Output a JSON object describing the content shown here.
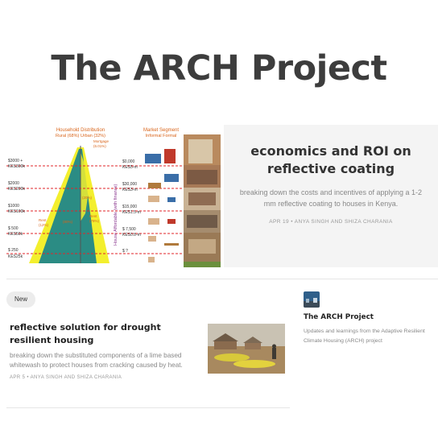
{
  "site": {
    "title": "The ARCH Project"
  },
  "featured": {
    "title": "economics and ROI on reflective coating",
    "subtitle": "breaking down the costs and incentives of applying a 1-2 mm reflective coating to houses in Kenya.",
    "meta": "APR 19 • ANYA SINGH AND SHIZA CHARANIA",
    "image": {
      "header_left": "Household Distribution",
      "header_left_sub": "Rural (68%)  Urban (32%)",
      "mortgage": "Mortgage",
      "mortgage_pct": "(6.01%)",
      "header_right": "Market Segment",
      "header_right_sub": "Informal  Formal",
      "left_labels": [
        [
          "$3000 +",
          "KES300k"
        ],
        [
          "$2000",
          "KES200k"
        ],
        [
          "$1000",
          "KES100k"
        ],
        [
          "$ 500",
          "KES50k"
        ],
        [
          "$ 250",
          "KES25k"
        ]
      ],
      "right_labels": [
        [
          "$0,000",
          "KES5-m"
        ],
        [
          "$30,000",
          "KES3-m"
        ],
        [
          "$15,000",
          "KES1.5-m"
        ],
        [
          "$ 7,500",
          "KES0.8-m"
        ],
        [
          "$ ?",
          ""
        ]
      ],
      "rent_left": "Rent",
      "rent_left_pct": "(12%)",
      "own_pct": "(80%)",
      "rent_right": "Rent",
      "rent_right_pct": "(78%)",
      "own_pct_2": "(20%)",
      "axis_label": "House Affordable (with finance)"
    }
  },
  "post": {
    "badge": "New",
    "title": "reflective solution for drought resilient housing",
    "subtitle": "breaking down the substituted components of a lime based whitewash to protect houses from cracking caused by heat.",
    "meta": "APR 5 • ANYA SINGH AND SHIZA CHARANIA"
  },
  "sidebar": {
    "title": "The ARCH Project",
    "description": "Updates and learnings from the Adaptive Resilient Climate Housing (ARCH) project"
  },
  "colors": {
    "pyramid_yellow": "#f3ef2e",
    "pyramid_teal": "#2b8c84",
    "dashed_red": "#e0242a",
    "label_orange": "#d9641a",
    "axis_purple": "#8c3b92"
  }
}
